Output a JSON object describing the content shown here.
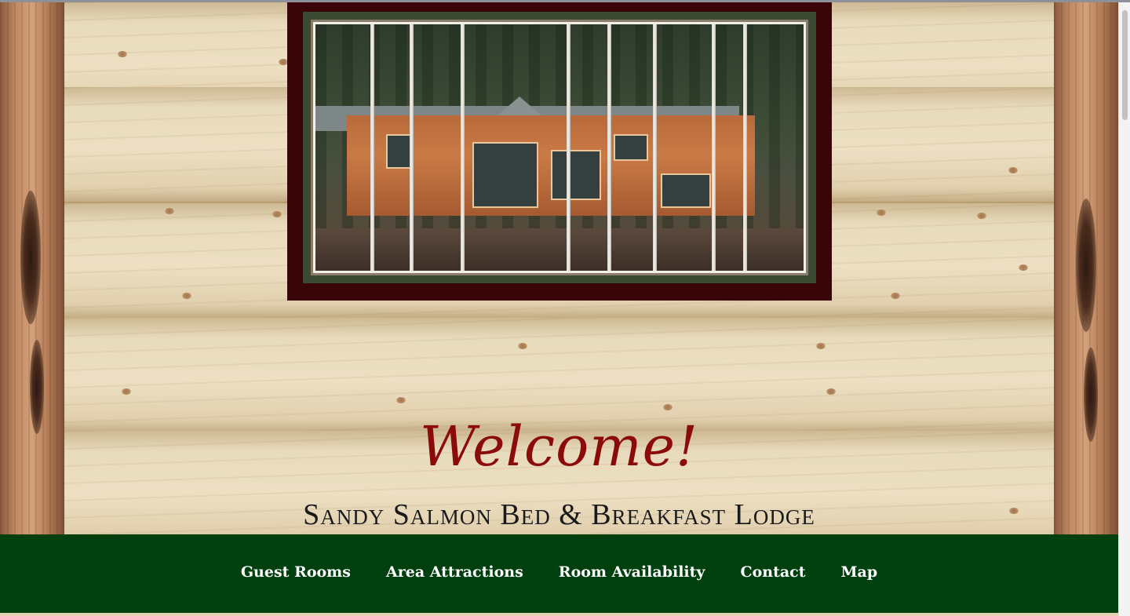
{
  "header": {
    "welcome": "Welcome!",
    "lodge_name": "Sandy Salmon Bed & Breakfast Lodge"
  },
  "hero_image": {
    "description": "Log lodge among birch trees"
  },
  "nav": {
    "items": [
      {
        "label": "Guest Rooms"
      },
      {
        "label": "Area Attractions"
      },
      {
        "label": "Room Availability"
      },
      {
        "label": "Contact"
      },
      {
        "label": "Map"
      }
    ]
  },
  "colors": {
    "nav_bg": "#003f0e",
    "welcome": "#8b0a0a",
    "frame": "#3a0508"
  }
}
